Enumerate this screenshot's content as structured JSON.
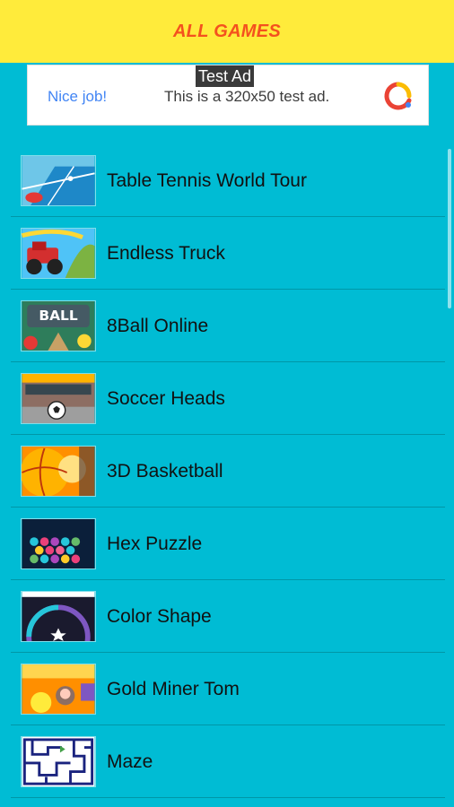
{
  "header": {
    "title": "ALL GAMES"
  },
  "ad": {
    "label": "Test Ad",
    "nice_text": "Nice job!",
    "text": "This is a 320x50 test ad."
  },
  "games": [
    {
      "name": "Table Tennis World Tour"
    },
    {
      "name": "Endless Truck"
    },
    {
      "name": "8Ball Online"
    },
    {
      "name": "Soccer Heads"
    },
    {
      "name": "3D Basketball"
    },
    {
      "name": "Hex Puzzle"
    },
    {
      "name": "Color Shape"
    },
    {
      "name": "Gold Miner Tom"
    },
    {
      "name": "Maze"
    }
  ],
  "colors": {
    "header_bg": "#ffeb3b",
    "header_text": "#f4511e",
    "list_bg": "#00bcd4"
  }
}
